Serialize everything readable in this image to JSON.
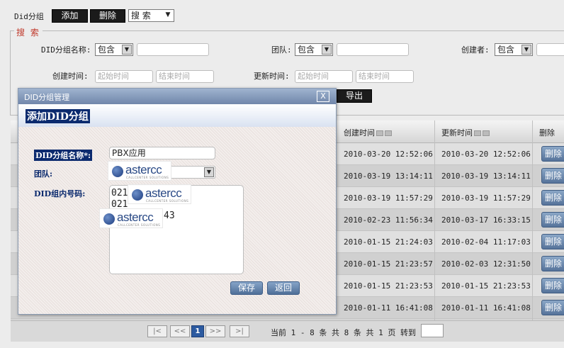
{
  "toolbar": {
    "title": "Did分组",
    "add_label": "添加",
    "delete_label": "删除",
    "search_select": "搜 索"
  },
  "search": {
    "legend": "搜 索",
    "group_name_label": "DID分组名称:",
    "group_name_op": "包含",
    "team_label": "团队:",
    "team_op": "包含",
    "creator_label": "创建者:",
    "creator_op": "包含",
    "created_label": "创建时间:",
    "created_start_ph": "起始时间",
    "created_end_ph": "结束时间",
    "updated_label": "更新时间:",
    "updated_start_ph": "起始时间",
    "updated_end_ph": "结束时间",
    "export_label": "导出"
  },
  "table": {
    "headers": {
      "created": "创建时间",
      "updated": "更新时间",
      "delete": "删除"
    },
    "delete_label": "删除",
    "rows": [
      {
        "created": "2010-03-20 12:52:06",
        "updated": "2010-03-20 12:52:06"
      },
      {
        "created": "2010-03-19 13:14:11",
        "updated": "2010-03-19 13:14:11"
      },
      {
        "created": "2010-03-19 11:57:29",
        "updated": "2010-03-19 11:57:29"
      },
      {
        "created": "2010-02-23 11:56:34",
        "updated": "2010-03-17 16:33:15"
      },
      {
        "created": "2010-01-15 21:24:03",
        "updated": "2010-02-04 11:17:03"
      },
      {
        "created": "2010-01-15 21:23:57",
        "updated": "2010-02-03 12:31:50"
      },
      {
        "created": "2010-01-15 21:23:53",
        "updated": "2010-01-15 21:23:53"
      },
      {
        "created": "2010-01-11 16:41:08",
        "updated": "2010-01-11 16:41:08"
      }
    ]
  },
  "pager": {
    "first": "|<",
    "prev": "<<",
    "current": "1",
    "next": ">>",
    "last": ">|",
    "summary": "当前 1 - 8 条 共 8 条 共 1 页 转到"
  },
  "modal": {
    "window_title": "DID分组管理",
    "close": "X",
    "heading": "添加DID分组",
    "name_label": "DID分组名称*:",
    "name_value": "PBX应用",
    "team_label": "团队:",
    "numbers_label": "DID组内号码:",
    "numbers_line1": "021",
    "numbers_line2": "021",
    "numbers_line3": "43",
    "save_label": "保存",
    "back_label": "返回"
  },
  "watermark": {
    "brand": "astercc",
    "tagline": "CALLCENTER SOLUTIONS"
  },
  "colors": {
    "modal_header": "#7086aa",
    "heading_bg": "#0b2a6e",
    "button_blue": "#56739a",
    "pager_current": "#2c5aa0"
  }
}
